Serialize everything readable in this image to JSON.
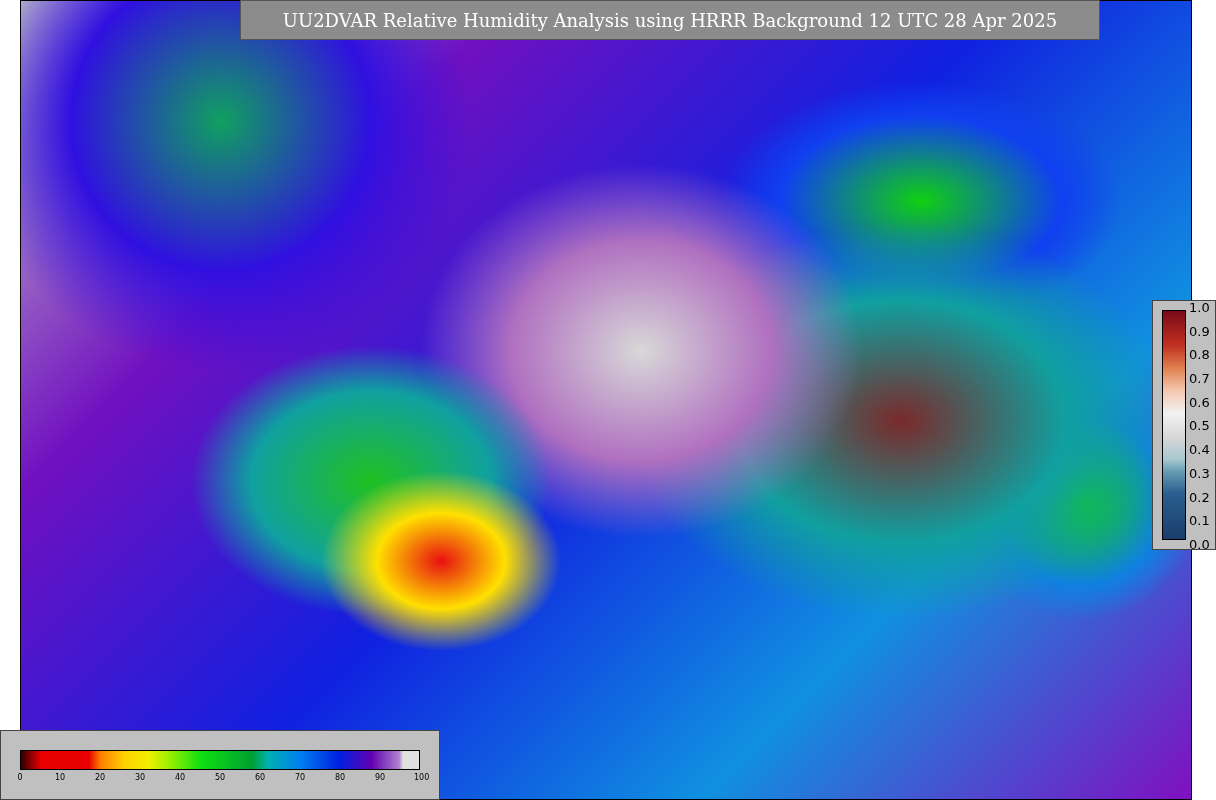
{
  "title": "UU2DVAR Relative Humidity Analysis using HRRR Background 12 UTC 28 Apr 2025",
  "weight_colorbar": {
    "ticks": [
      "1.0",
      "0.9",
      "0.8",
      "0.7",
      "0.6",
      "0.5",
      "0.4",
      "0.3",
      "0.2",
      "0.1",
      "0.0"
    ]
  },
  "humidity_colorbar": {
    "ticks": [
      "0",
      "10",
      "20",
      "30",
      "40",
      "50",
      "60",
      "70",
      "80",
      "90",
      "100"
    ]
  }
}
